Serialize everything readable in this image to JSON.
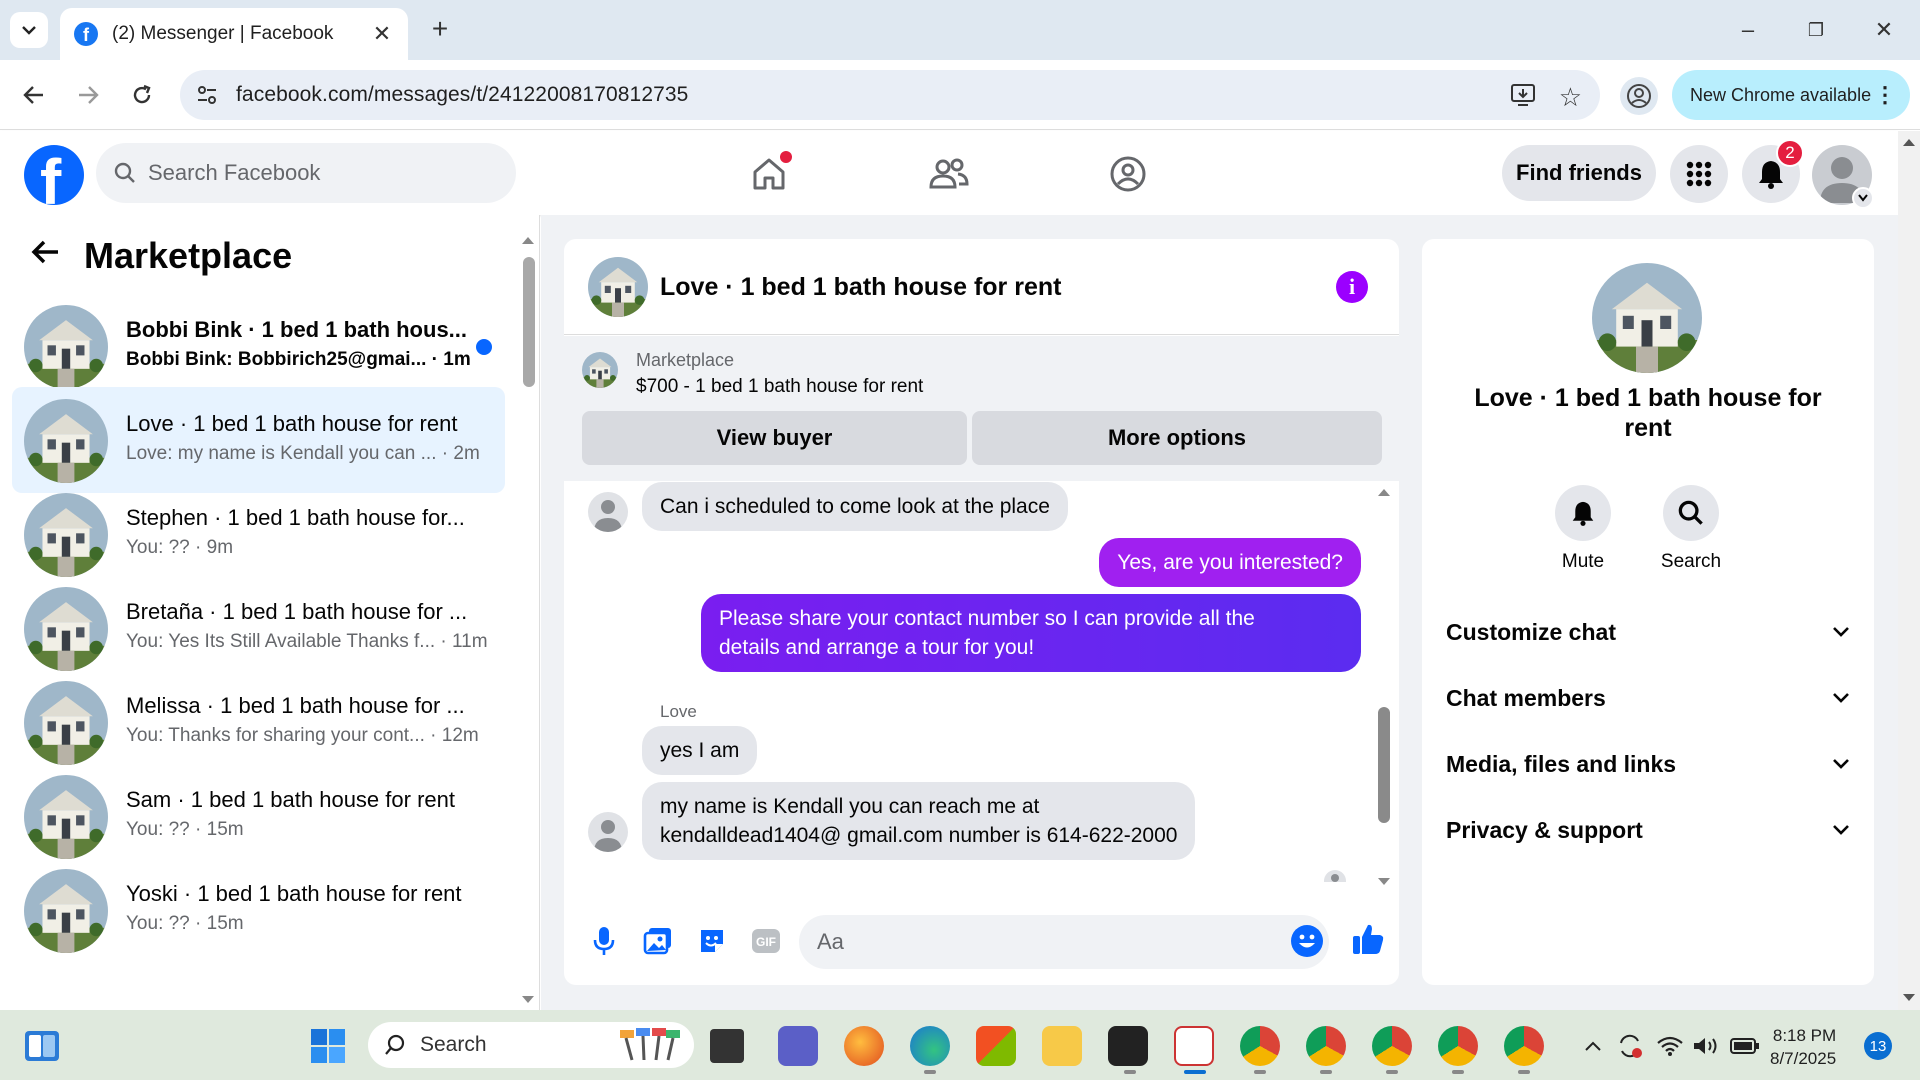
{
  "browser": {
    "tab_title": "(2) Messenger | Facebook",
    "tab_close": "✕",
    "new_tab": "+",
    "url": "facebook.com/messages/t/24122008170812735",
    "new_chrome_label": "New Chrome available",
    "window_controls": [
      "–",
      "❐",
      "✕"
    ]
  },
  "fb_header": {
    "search_placeholder": "Search Facebook",
    "find_friends_label": "Find friends",
    "notification_count": "2"
  },
  "left_panel": {
    "title": "Marketplace",
    "conversations": [
      {
        "title": "Bobbi Bink · 1 bed 1 bath hous...",
        "subtitle": "Bobbi Bink: Bobbirich25@gmai... · 1m",
        "unread": true,
        "selected": false
      },
      {
        "title": "Love · 1 bed 1 bath house for rent",
        "subtitle": "Love: my name is Kendall you can ... · 2m",
        "unread": false,
        "selected": true
      },
      {
        "title": "Stephen · 1 bed 1 bath house for...",
        "subtitle": "You: ?? · 9m",
        "unread": false,
        "selected": false
      },
      {
        "title": "Bretaña · 1 bed 1 bath house for ...",
        "subtitle": "You: Yes Its Still Available Thanks f... · 11m",
        "unread": false,
        "selected": false
      },
      {
        "title": "Melissa · 1 bed 1 bath house for ...",
        "subtitle": "You: Thanks for sharing your cont... · 12m",
        "unread": false,
        "selected": false
      },
      {
        "title": "Sam · 1 bed 1 bath house for rent",
        "subtitle": "You: ?? · 15m",
        "unread": false,
        "selected": false
      },
      {
        "title": "Yoski · 1 bed 1 bath house for rent",
        "subtitle": "You: ?? · 15m",
        "unread": false,
        "selected": false
      }
    ]
  },
  "chat": {
    "title": "Love · 1 bed 1 bath house for rent",
    "info_glyph": "i",
    "listing_source": "Marketplace",
    "listing_desc": "$700 - 1 bed 1 bath house for rent",
    "view_buyer_label": "View buyer",
    "more_options_label": "More options",
    "messages": {
      "m1": "Can i scheduled to come look at the place",
      "m2": "Yes, are you interested?",
      "m3_line1": "Please share your contact number so I can provide all the",
      "m3_line2": "details and arrange a tour for you!",
      "sender_label": "Love",
      "m4": "yes I am",
      "m5_line1": "my name is Kendall you can reach me at",
      "m5_line2": "kendalldead1404@ gmail.com number is 614-622-2000"
    },
    "input_placeholder": "Aa",
    "colors": {
      "outgoing_start": "#a020f0",
      "outgoing_end": "#5b2cf0",
      "incoming": "#e4e6eb",
      "accent": "#0866ff"
    }
  },
  "info_panel": {
    "title": "Love · 1 bed 1 bath house for rent",
    "mute_label": "Mute",
    "search_label": "Search",
    "sections": [
      "Customize chat",
      "Chat members",
      "Media, files and links",
      "Privacy & support"
    ]
  },
  "taskbar": {
    "search_label": "Search",
    "time": "8:18 PM",
    "date": "8/7/2025",
    "badge_count": "13"
  }
}
